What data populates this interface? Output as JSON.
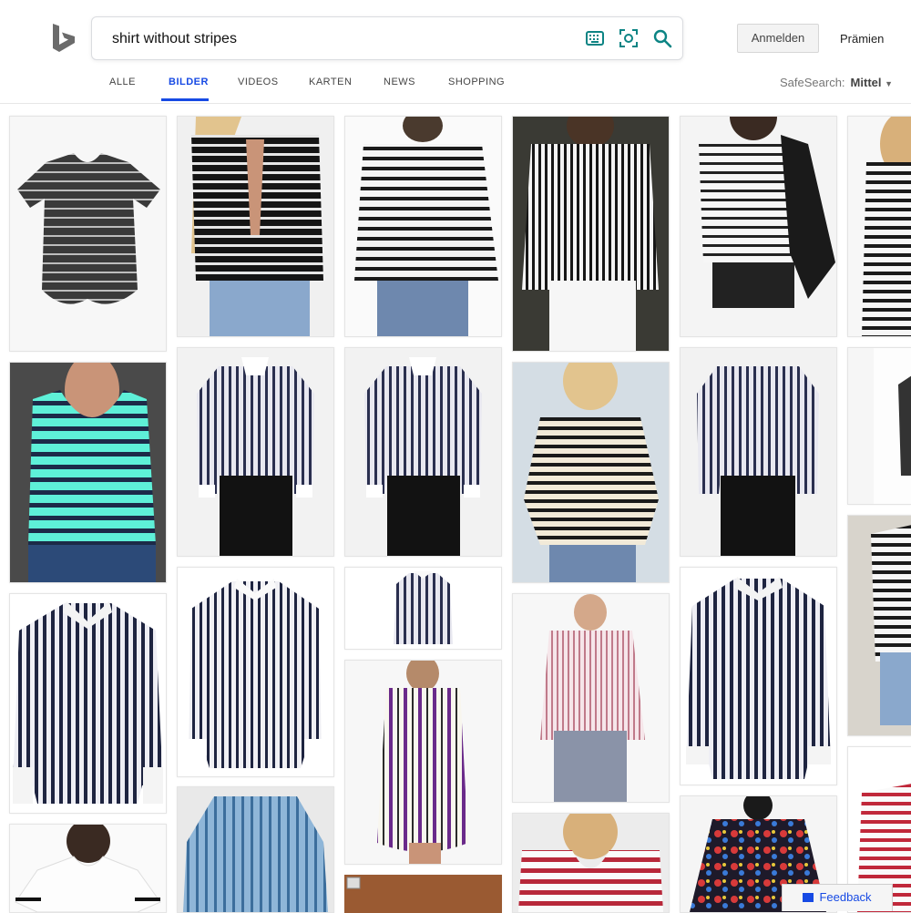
{
  "search": {
    "query": "shirt without stripes"
  },
  "header": {
    "signin_label": "Anmelden",
    "rewards_label": "Prämien"
  },
  "tabs": [
    {
      "label": "ALLE"
    },
    {
      "label": "BILDER",
      "active": true
    },
    {
      "label": "VIDEOS"
    },
    {
      "label": "KARTEN"
    },
    {
      "label": "NEWS"
    },
    {
      "label": "SHOPPING"
    }
  ],
  "safesearch": {
    "label": "SafeSearch:",
    "value": "Mittel"
  },
  "feedback_label": "Feedback",
  "icons": {
    "logo": "bing-logo-icon",
    "keyboard": "keyboard-icon",
    "visual_search": "visual-search-icon",
    "search": "search-icon",
    "feedback": "feedback-icon",
    "dropdown": "caret-down-icon"
  },
  "colors": {
    "accent": "#174ae4",
    "icon_teal": "#0c8484",
    "logo": "#6b6b6b"
  }
}
